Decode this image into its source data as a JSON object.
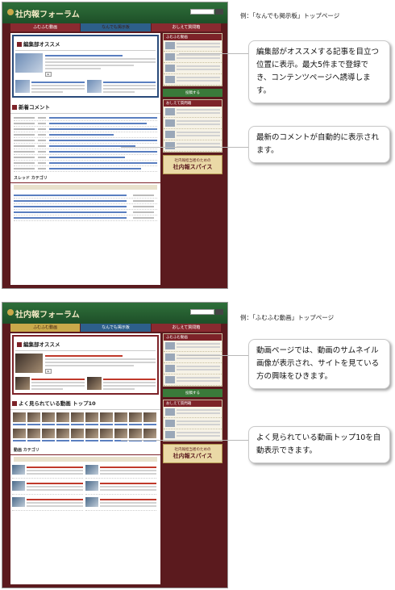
{
  "captions": [
    "例：「なんでも掲示板」トップページ",
    "例：「ふむふむ動画」トップページ"
  ],
  "callouts": [
    "編集部がオススメする記事を目立つ位置に表示。最大5件まで登録でき、コンテンツページへ誘導します。",
    "最新のコメントが自動的に表示されます。",
    "動画ページでは、動画のサムネイル画像が表示され、サイトを見ている方の興味をひきます。",
    "よく見られている動画トップ10を自動表示できます。"
  ],
  "site": {
    "logo": "社内報フォーラム",
    "tabs": [
      "ふむふむ動画",
      "なんでも掲示板",
      "おしえて質問箱"
    ],
    "side_heads": [
      "ふむふむ動画",
      "おしえて質問箱"
    ],
    "side_button": "投稿する",
    "ad_sub": "社内報担当者のための",
    "ad_title": "社内報スパイス"
  },
  "board": {
    "rec_title": "編集部オススメ",
    "comment_title": "新着コメント",
    "thread_title": "スレッド カテゴリ"
  },
  "video": {
    "rec_title": "編集部オススメ",
    "top10_title": "よく見られている動画 トップ10",
    "cat_title": "動画 カテゴリ"
  }
}
